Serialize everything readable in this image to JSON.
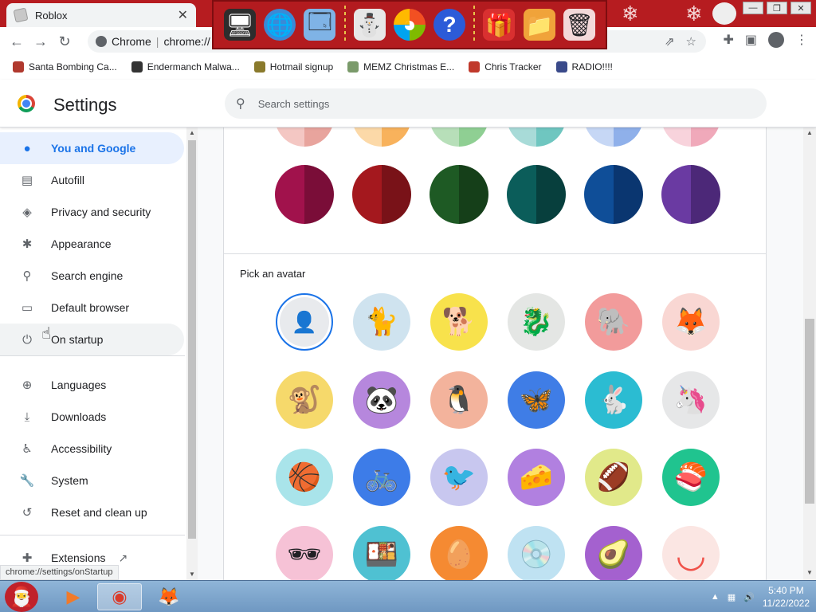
{
  "window": {
    "tab_title": "Roblox",
    "tab_close": "✕",
    "controls": [
      "—",
      "❐",
      "✕"
    ]
  },
  "toolbar": {
    "omnibox_chip": "Chrome",
    "omnibox_url": "chrome://"
  },
  "bookmarks": [
    {
      "label": "Santa Bombing Ca...",
      "icon": "santa-icon",
      "color": "#b0392e"
    },
    {
      "label": "Endermanch Malwa...",
      "icon": "cat-icon",
      "color": "#333333"
    },
    {
      "label": "Hotmail signup",
      "icon": "person-icon",
      "color": "#8a7a2c"
    },
    {
      "label": "MEMZ Christmas E...",
      "icon": "nyan-icon",
      "color": "#7a9a6a"
    },
    {
      "label": "Chris Tracker",
      "icon": "star-icon",
      "color": "#c0392b"
    },
    {
      "label": "RADIO!!!!",
      "icon": "diamond-icon",
      "color": "#3a4a8a"
    }
  ],
  "settings": {
    "title": "Settings",
    "search_placeholder": "Search settings"
  },
  "sidebar": {
    "items": [
      {
        "label": "You and Google",
        "icon": "person-icon",
        "glyph": "●",
        "state": "active"
      },
      {
        "label": "Autofill",
        "icon": "clipboard-icon",
        "glyph": "▤"
      },
      {
        "label": "Privacy and security",
        "icon": "shield-icon",
        "glyph": "◈"
      },
      {
        "label": "Appearance",
        "icon": "palette-icon",
        "glyph": "✱"
      },
      {
        "label": "Search engine",
        "icon": "search-icon",
        "glyph": "⚲"
      },
      {
        "label": "Default browser",
        "icon": "browser-icon",
        "glyph": "▭"
      },
      {
        "label": "On startup",
        "icon": "power-icon",
        "glyph": "⏻",
        "state": "hover"
      },
      {
        "label": "Languages",
        "icon": "globe-icon",
        "glyph": "⊕"
      },
      {
        "label": "Downloads",
        "icon": "download-icon",
        "glyph": "⤓"
      },
      {
        "label": "Accessibility",
        "icon": "accessibility-icon",
        "glyph": "♿"
      },
      {
        "label": "System",
        "icon": "wrench-icon",
        "glyph": "🔧"
      },
      {
        "label": "Reset and clean up",
        "icon": "history-icon",
        "glyph": "↺"
      },
      {
        "label": "Extensions",
        "icon": "puzzle-icon",
        "glyph": "✚"
      }
    ],
    "extensions_external_icon": "↗"
  },
  "main": {
    "colors_top_partial": [
      [
        "#f4c7c3",
        "#e8a49d"
      ],
      [
        "#fcd9a8",
        "#f8b25c"
      ],
      [
        "#b7dfb9",
        "#8fcf93"
      ],
      [
        "#a8dbd8",
        "#6fc6c0"
      ],
      [
        "#c6d7f5",
        "#8fb0ea"
      ],
      [
        "#f8d3dc",
        "#f0a9ba"
      ]
    ],
    "colors": [
      [
        "#a1124c",
        "#7a0d38"
      ],
      [
        "#a4181e",
        "#791218"
      ],
      [
        "#1e5a24",
        "#153f19"
      ],
      [
        "#0b5d5a",
        "#073f3d"
      ],
      [
        "#0f4e98",
        "#0a3670"
      ],
      [
        "#6a3aa2",
        "#4c2878"
      ]
    ],
    "pick_avatar_label": "Pick an avatar",
    "avatars": [
      {
        "name": "default-avatar",
        "glyph": "👤",
        "bg": "#e8eaed",
        "selected": true
      },
      {
        "name": "cat-avatar",
        "glyph": "🐈",
        "bg": "#cfe3ef"
      },
      {
        "name": "corgi-avatar",
        "glyph": "🐕",
        "bg": "#f8e24c"
      },
      {
        "name": "dragon-avatar",
        "glyph": "🐉",
        "bg": "#e4e6e4"
      },
      {
        "name": "elephant-avatar",
        "glyph": "🐘",
        "bg": "#f29b9b"
      },
      {
        "name": "fox-avatar",
        "glyph": "🦊",
        "bg": "#f9d7d3"
      },
      {
        "name": "monkey-avatar",
        "glyph": "🐒",
        "bg": "#f6d96b"
      },
      {
        "name": "panda-avatar",
        "glyph": "🐼",
        "bg": "#b687dd"
      },
      {
        "name": "penguin-avatar",
        "glyph": "🐧",
        "bg": "#f3b39c"
      },
      {
        "name": "butterfly-avatar",
        "glyph": "🦋",
        "bg": "#3f7de6"
      },
      {
        "name": "rabbit-avatar",
        "glyph": "🐇",
        "bg": "#2bbcd2"
      },
      {
        "name": "unicorn-avatar",
        "glyph": "🦄",
        "bg": "#e6e7e8"
      },
      {
        "name": "basketball-avatar",
        "glyph": "🏀",
        "bg": "#a9e4ea"
      },
      {
        "name": "bike-avatar",
        "glyph": "🚲",
        "bg": "#3d7ce8"
      },
      {
        "name": "bird-avatar",
        "glyph": "🐦",
        "bg": "#c8c7ef"
      },
      {
        "name": "cheese-avatar",
        "glyph": "🧀",
        "bg": "#b180e0"
      },
      {
        "name": "football-avatar",
        "glyph": "🏈",
        "bg": "#e1e98a"
      },
      {
        "name": "sushi-plate-avatar",
        "glyph": "🍣",
        "bg": "#20c48f"
      },
      {
        "name": "sunglasses-avatar",
        "glyph": "🕶",
        "bg": "#f6c2d6"
      },
      {
        "name": "sushi-avatar",
        "glyph": "🍱",
        "bg": "#4fc1d2"
      },
      {
        "name": "tamagotchi-avatar",
        "glyph": "🥚",
        "bg": "#f58a32"
      },
      {
        "name": "vinyl-avatar",
        "glyph": "💿",
        "bg": "#bfe2f2"
      },
      {
        "name": "avocado-avatar",
        "glyph": "🥑",
        "bg": "#a461cf"
      },
      {
        "name": "smile-avatar",
        "glyph": "◡",
        "bg": "#fbe6e3"
      }
    ]
  },
  "status_url": "chrome://settings/onStartup",
  "taskbar": {
    "time": "5:40 PM",
    "date": "11/22/2022",
    "start_glyph": "🎅",
    "apps": [
      {
        "name": "media-player-icon",
        "glyph": "▶"
      },
      {
        "name": "chrome-icon",
        "glyph": "◉",
        "active": true
      },
      {
        "name": "firefox-icon",
        "glyph": "🦊"
      }
    ]
  },
  "toybar_items": [
    {
      "name": "computer-icon",
      "glyph": "🖥"
    },
    {
      "name": "globe-network-icon",
      "glyph": "🌐"
    },
    {
      "name": "window-icon",
      "glyph": "🗔"
    },
    {
      "name": "snowman-icon",
      "glyph": "⛄"
    },
    {
      "name": "windows-logo-icon",
      "glyph": "◕"
    },
    {
      "name": "help-icon",
      "glyph": "?"
    },
    {
      "name": "gift-icon",
      "glyph": "🎁"
    },
    {
      "name": "folder-icon",
      "glyph": "📁"
    },
    {
      "name": "recycle-bin-icon",
      "glyph": "🗑"
    }
  ]
}
